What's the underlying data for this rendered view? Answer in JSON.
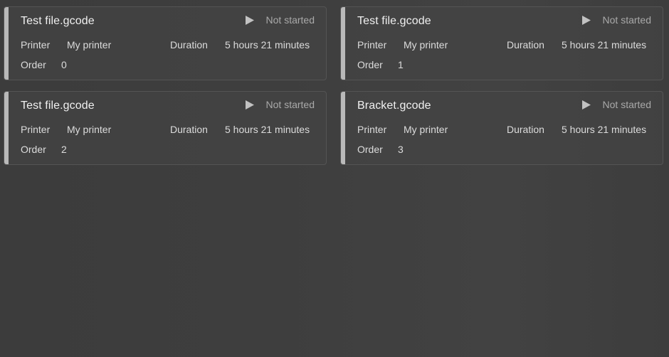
{
  "labels": {
    "printer": "Printer",
    "duration": "Duration",
    "order": "Order"
  },
  "colors": {
    "accent": "#b9b9b9",
    "status_text": "#a9a9a9",
    "card_border": "#545454"
  },
  "jobs": [
    {
      "title": "Test file.gcode",
      "status": "Not started",
      "status_icon": "play-icon",
      "printer": "My printer",
      "duration": "5 hours 21 minutes",
      "order": "0"
    },
    {
      "title": "Test file.gcode",
      "status": "Not started",
      "status_icon": "play-icon",
      "printer": "My printer",
      "duration": "5 hours 21 minutes",
      "order": "1"
    },
    {
      "title": "Test file.gcode",
      "status": "Not started",
      "status_icon": "play-icon",
      "printer": "My printer",
      "duration": "5 hours 21 minutes",
      "order": "2"
    },
    {
      "title": "Bracket.gcode",
      "status": "Not started",
      "status_icon": "play-icon",
      "printer": "My printer",
      "duration": "5 hours 21 minutes",
      "order": "3"
    }
  ]
}
